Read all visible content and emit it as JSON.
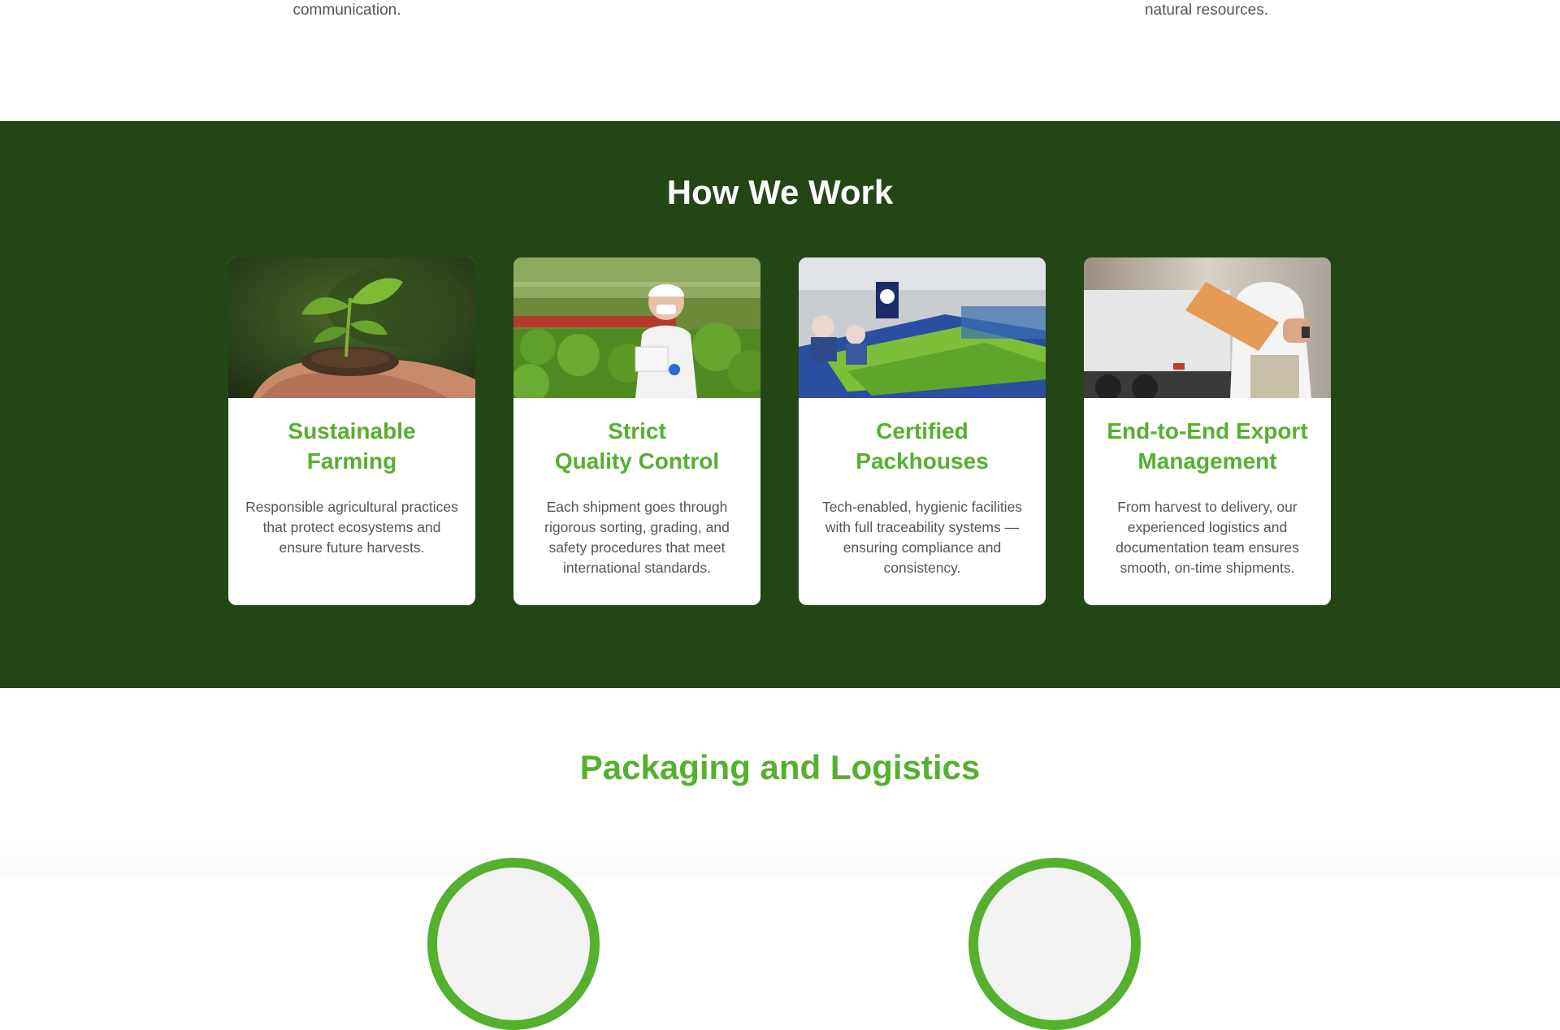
{
  "top": {
    "left_text": "communication.",
    "right_text": "natural resources."
  },
  "how_we_work": {
    "title": "How We Work",
    "cards": [
      {
        "title": "Sustainable\nFarming",
        "description": "Responsible agricultural practices that protect ecosystems and ensure future harvests.",
        "image": "hands-holding-seedling-image"
      },
      {
        "title": "Strict\nQuality Control",
        "description": "Each shipment goes through rigorous sorting, grading, and safety procedures that meet international standards.",
        "image": "greenhouse-inspector-image"
      },
      {
        "title": "Certified\nPackhouses",
        "description": "Tech-enabled, hygienic facilities with full traceability systems — ensuring compliance and consistency.",
        "image": "packhouse-sorting-line-image"
      },
      {
        "title": "End-to-End Export\nManagement",
        "description": "From harvest to delivery, our experienced logistics and documentation team ensures smooth, on-time shipments.",
        "image": "truck-clipboard-image"
      }
    ]
  },
  "packaging": {
    "title": "Packaging and Logistics"
  },
  "colors": {
    "dark_green": "#234615",
    "accent_green": "#55b02e",
    "body_text": "#555555"
  }
}
